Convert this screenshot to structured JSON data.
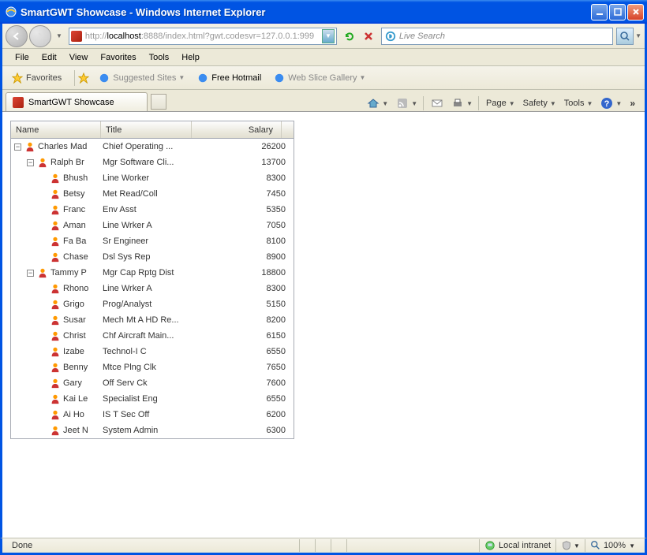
{
  "window": {
    "title": "SmartGWT Showcase - Windows Internet Explorer"
  },
  "address": {
    "protocol": "http://",
    "host": "localhost",
    "port_path": ":8888/index.html?gwt.codesvr=127.0.0.1:999"
  },
  "search": {
    "placeholder": "Live Search"
  },
  "menu": {
    "items": [
      "File",
      "Edit",
      "View",
      "Favorites",
      "Tools",
      "Help"
    ]
  },
  "favbar": {
    "label": "Favorites",
    "links": [
      {
        "label": "Suggested Sites",
        "dropdown": true
      },
      {
        "label": "Free Hotmail",
        "bold": true
      },
      {
        "label": "Web Slice Gallery",
        "dropdown": true
      }
    ]
  },
  "tab": {
    "label": "SmartGWT Showcase"
  },
  "cmdbar": {
    "items": [
      "Page",
      "Safety",
      "Tools"
    ]
  },
  "grid": {
    "headers": {
      "name": "Name",
      "title": "Title",
      "salary": "Salary"
    },
    "rows": [
      {
        "depth": 0,
        "expand": "minus",
        "name": "Charles Mad",
        "title": "Chief Operating ...",
        "salary": 26200
      },
      {
        "depth": 1,
        "expand": "minus",
        "name": "Ralph Br",
        "title": "Mgr Software Cli...",
        "salary": 13700
      },
      {
        "depth": 2,
        "expand": "none",
        "name": "Bhush",
        "title": "Line Worker",
        "salary": 8300
      },
      {
        "depth": 2,
        "expand": "none",
        "name": "Betsy",
        "title": "Met Read/Coll",
        "salary": 7450
      },
      {
        "depth": 2,
        "expand": "none",
        "name": "Franc",
        "title": "Env Asst",
        "salary": 5350
      },
      {
        "depth": 2,
        "expand": "none",
        "name": "Aman",
        "title": "Line Wrker A",
        "salary": 7050
      },
      {
        "depth": 2,
        "expand": "none",
        "name": "Fa Ba",
        "title": "Sr Engineer",
        "salary": 8100
      },
      {
        "depth": 2,
        "expand": "none",
        "name": "Chase",
        "title": "Dsl Sys Rep",
        "salary": 8900
      },
      {
        "depth": 1,
        "expand": "minus",
        "name": "Tammy P",
        "title": "Mgr Cap Rptg Dist",
        "salary": 18800
      },
      {
        "depth": 2,
        "expand": "none",
        "name": "Rhono",
        "title": "Line Wrker A",
        "salary": 8300
      },
      {
        "depth": 2,
        "expand": "none",
        "name": "Grigo",
        "title": "Prog/Analyst",
        "salary": 5150
      },
      {
        "depth": 2,
        "expand": "none",
        "name": "Susar",
        "title": "Mech Mt A HD Re...",
        "salary": 8200
      },
      {
        "depth": 2,
        "expand": "none",
        "name": "Christ",
        "title": "Chf Aircraft Main...",
        "salary": 6150
      },
      {
        "depth": 2,
        "expand": "none",
        "name": "Izabe",
        "title": "Technol-I C",
        "salary": 6550
      },
      {
        "depth": 2,
        "expand": "none",
        "name": "Benny",
        "title": "Mtce Plng Clk",
        "salary": 7650
      },
      {
        "depth": 2,
        "expand": "none",
        "name": "Gary",
        "title": "Off Serv Ck",
        "salary": 7600
      },
      {
        "depth": 2,
        "expand": "none",
        "name": "Kai Le",
        "title": "Specialist Eng",
        "salary": 6550
      },
      {
        "depth": 2,
        "expand": "none",
        "name": "Ai Ho",
        "title": "IS T Sec Off",
        "salary": 6200
      },
      {
        "depth": 2,
        "expand": "none",
        "name": "Jeet N",
        "title": "System Admin",
        "salary": 6300
      }
    ]
  },
  "status": {
    "left": "Done",
    "zone": "Local intranet",
    "zoom": "100%"
  }
}
